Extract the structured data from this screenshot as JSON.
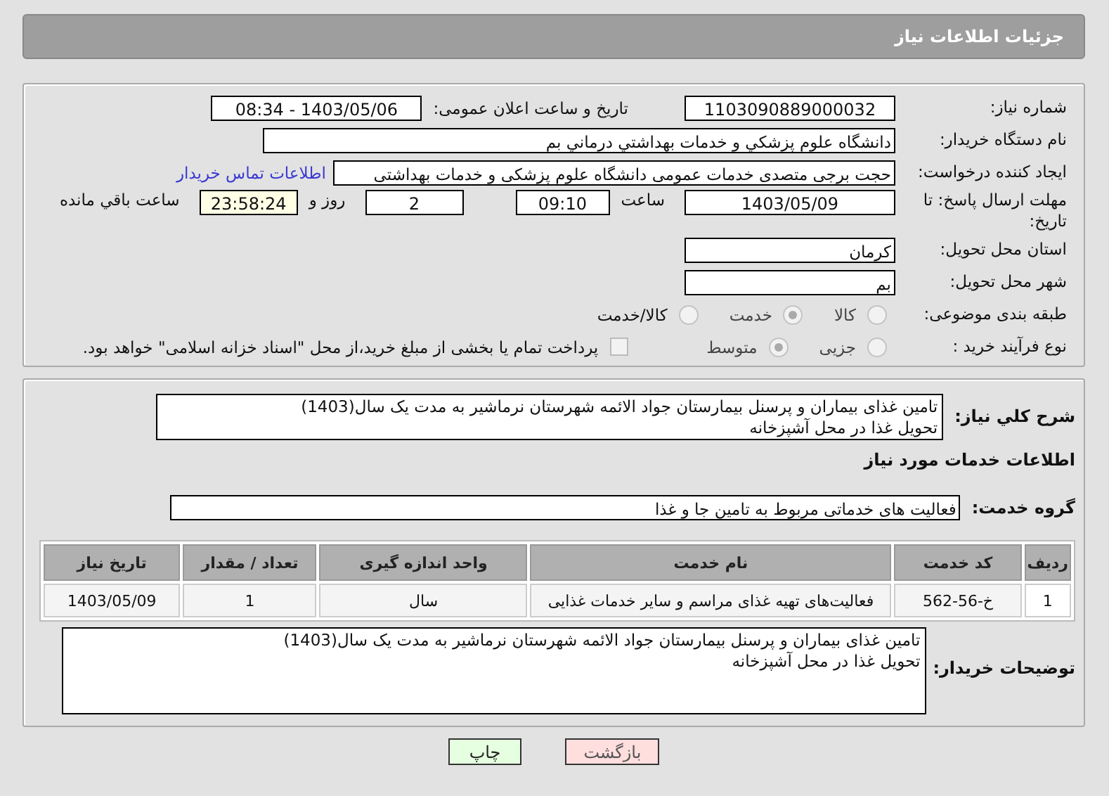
{
  "header": {
    "title": "جزئیات اطلاعات نیاز"
  },
  "need_info": {
    "need_number": {
      "label": "شماره نیاز:",
      "value": "1103090889000032"
    },
    "announce": {
      "label": "تاریخ و ساعت اعلان عمومی:",
      "value": "1403/05/06 - 08:34"
    },
    "buyer": {
      "label": "نام دستگاه خریدار:",
      "value": "دانشگاه علوم پزشکي و خدمات بهداشتي  درماني بم"
    },
    "creator": {
      "label": "ایجاد کننده درخواست:",
      "value": "حجت برجی متصدی خدمات عمومی دانشگاه علوم پزشکی و خدمات بهداشتی",
      "link": "اطلاعات تماس خریدار"
    },
    "deadline": {
      "label": "مهلت ارسال پاسخ: تا تاریخ:",
      "date": "1403/05/09",
      "time_label": "ساعت",
      "time": "09:10",
      "days": "2",
      "days_label": "روز و",
      "remaining": "23:58:24",
      "remaining_label": "ساعت باقي مانده"
    },
    "province": {
      "label": "استان محل تحویل:",
      "value": "کرمان"
    },
    "city": {
      "label": "شهر محل تحویل:",
      "value": "بم"
    },
    "category": {
      "label": "طبقه بندی موضوعی:",
      "options": [
        {
          "label": "کالا",
          "selected": false
        },
        {
          "label": "خدمت",
          "selected": true
        },
        {
          "label": "کالا/خدمت",
          "selected": false
        }
      ]
    },
    "process": {
      "label": "نوع فرآیند خرید :",
      "options": [
        {
          "label": "جزیی",
          "selected": false
        },
        {
          "label": "متوسط",
          "selected": true
        }
      ],
      "treasury": {
        "checked": false,
        "label": "پرداخت تمام یا بخشی از مبلغ خرید،از محل \"اسناد خزانه اسلامی\" خواهد بود."
      }
    }
  },
  "details": {
    "summary": {
      "label": "شرح کلي نیاز:",
      "value": "تامین غذای بیماران و پرسنل بیمارستان جواد الائمه شهرستان نرماشیر به مدت یک سال(1403)\nتحویل غذا در محل آشپزخانه"
    },
    "section_title": "اطلاعات خدمات مورد نیاز",
    "service_group": {
      "label": "گروه خدمت:",
      "value": "فعالیت های خدماتی مربوط به تامین جا و غذا"
    },
    "table": {
      "columns": [
        "ردیف",
        "کد خدمت",
        "نام خدمت",
        "واحد اندازه گیری",
        "تعداد / مقدار",
        "تاریخ نیاز"
      ],
      "rows": [
        [
          "1",
          "خ-56-562",
          "فعالیت‌های تهیه غذای مراسم و سایر خدمات غذایی",
          "سال",
          "1",
          "1403/05/09"
        ]
      ]
    },
    "buyer_notes": {
      "label": "توضیحات خریدار:",
      "value": "تامین غذای بیماران و پرسنل بیمارستان جواد الائمه شهرستان نرماشیر به مدت یک سال(1403)\nتحویل غذا در محل آشپزخانه"
    }
  },
  "buttons": [
    {
      "kind": "back",
      "label": "بازگشت"
    },
    {
      "kind": "print",
      "label": "چاپ"
    }
  ]
}
